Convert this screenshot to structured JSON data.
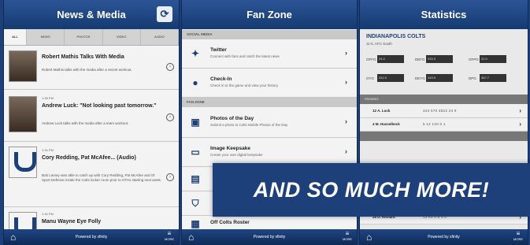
{
  "news": {
    "title": "News & Media",
    "refresh_icon": "refresh-icon",
    "tabs": [
      "ALL",
      "NEWS",
      "PHOTOS",
      "VIDEO",
      "AUDIO"
    ],
    "items": [
      {
        "meta": "",
        "title": "Robert Mathis Talks With Media",
        "body": "Robert Mathis talks with the media after a recent workout."
      },
      {
        "meta": "1:38 PM",
        "title": "Andrew Luck: \"Not looking past tomorrow.\"",
        "body": "Andrew Luck talks with the media after a team workout."
      },
      {
        "meta": "1:34 PM",
        "title": "Cory Redding, Pat McAfee... (Audio)",
        "body": "Bob Lamey was able to catch up with Cory Redding, Pat McAfee and Ol Sport Defense inside the Colts locker room prior to OTAs starting next week."
      },
      {
        "meta": "1:30 PM",
        "title": "Manu Wayne Eye Folly",
        "body": ""
      }
    ]
  },
  "fanzone": {
    "title": "Fan Zone",
    "sections": [
      "SOCIAL MEDIA",
      "FAN ZONE"
    ],
    "items": [
      {
        "icon": "twitter-icon",
        "title": "Twitter",
        "sub": "Connect with fans and catch the latest news"
      },
      {
        "icon": "location-pin-icon",
        "title": "Check-In",
        "sub": "Check in to the game and view your history"
      },
      {
        "icon": "photo-icon",
        "title": "Photos of the Day",
        "sub": "Submit a photo to Colts Mobile Photos of the Day"
      },
      {
        "icon": "image-keepsake-icon",
        "title": "Image Keepsake",
        "sub": "Create your own digital keepsake"
      },
      {
        "icon": "book-icon",
        "title": "",
        "sub": ""
      },
      {
        "icon": "shield-icon",
        "title": "",
        "sub": ""
      },
      {
        "icon": "roster-icon",
        "title": "Off Colts Roster",
        "sub": ""
      }
    ]
  },
  "stats": {
    "title": "Statistics",
    "team": "INDIANAPOLIS COLTS",
    "record": "11-5, AFC South",
    "cells": [
      {
        "label": "OFFG",
        "value": "24.4"
      },
      {
        "label": "DEFG",
        "value": "333.3"
      },
      {
        "label": "OFPG",
        "value": "22.0"
      },
      {
        "label": "OYG",
        "value": "342.0"
      },
      {
        "label": "DEYG",
        "value": "349.5"
      },
      {
        "label": "DPG",
        "value": "367.7"
      }
    ],
    "header": "PASSING",
    "rows": [
      {
        "name": "12  A. Luck",
        "nums": "343  570  3822  23  9"
      },
      {
        "name": "4  M. Hasselbeck",
        "nums": "5  12  130  0  1"
      },
      {
        "name": "25  D. Richard",
        "nums": "13  63  4.8  0  0"
      }
    ]
  },
  "footer": {
    "powered": "Powered by xfinity",
    "more": "MORE"
  },
  "banner": "AND SO MUCH MORE!"
}
